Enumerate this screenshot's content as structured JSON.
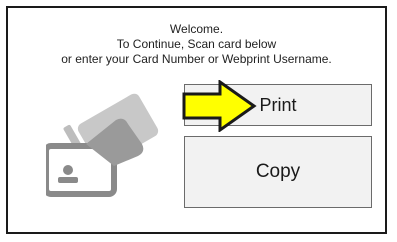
{
  "welcome": {
    "line1": "Welcome.",
    "line2": "To Continue, Scan card below",
    "line3": "or enter your Card Number or Webprint Username."
  },
  "buttons": {
    "print_label": "Print",
    "copy_label": "Copy"
  },
  "icons": {
    "card_scan": "card-scan-icon",
    "pointer_arrow": "arrow-right-icon"
  },
  "colors": {
    "arrow_fill": "#ffff00",
    "arrow_stroke": "#1a1a1a",
    "button_bg": "#f2f2f2",
    "card_icon": "#9a9a9a"
  }
}
